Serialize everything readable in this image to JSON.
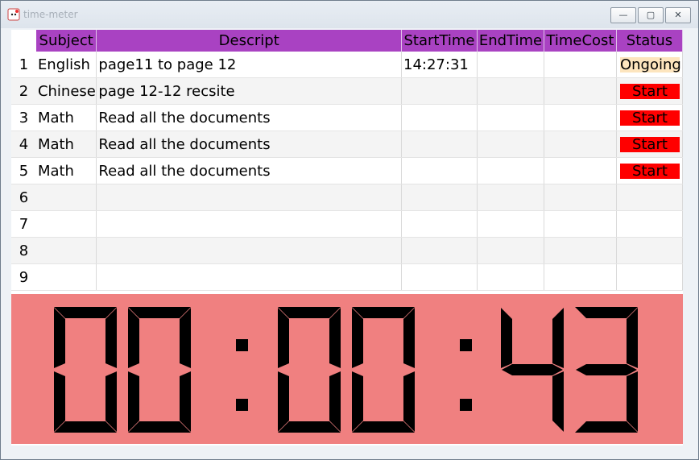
{
  "window": {
    "title": "time-meter",
    "minimize_glyph": "—",
    "maximize_glyph": "▢",
    "close_glyph": "✕"
  },
  "table": {
    "headers": [
      "Subject",
      "Descript",
      "StartTime",
      "EndTime",
      "TimeCost",
      "Status"
    ],
    "rows": [
      {
        "num": "1",
        "subject": "English",
        "descript": "page11 to page 12",
        "start": "14:27:31",
        "end": "",
        "cost": "",
        "status": "Ongoing"
      },
      {
        "num": "2",
        "subject": "Chinese",
        "descript": "page 12-12 recsite",
        "start": "",
        "end": "",
        "cost": "",
        "status": "Start"
      },
      {
        "num": "3",
        "subject": "Math",
        "descript": "Read all the documents",
        "start": "",
        "end": "",
        "cost": "",
        "status": "Start"
      },
      {
        "num": "4",
        "subject": "Math",
        "descript": "Read all the documents",
        "start": "",
        "end": "",
        "cost": "",
        "status": "Start"
      },
      {
        "num": "5",
        "subject": "Math",
        "descript": "Read all the documents",
        "start": "",
        "end": "",
        "cost": "",
        "status": "Start"
      },
      {
        "num": "6",
        "subject": "",
        "descript": "",
        "start": "",
        "end": "",
        "cost": "",
        "status": ""
      },
      {
        "num": "7",
        "subject": "",
        "descript": "",
        "start": "",
        "end": "",
        "cost": "",
        "status": ""
      },
      {
        "num": "8",
        "subject": "",
        "descript": "",
        "start": "",
        "end": "",
        "cost": "",
        "status": ""
      },
      {
        "num": "9",
        "subject": "",
        "descript": "",
        "start": "",
        "end": "",
        "cost": "",
        "status": ""
      }
    ]
  },
  "timer": {
    "display": "00:00:43"
  },
  "colors": {
    "header_bg": "#a942c2",
    "clock_bg": "#f08080",
    "ongoing_bg": "#fde5be",
    "start_bg": "#ff0000",
    "segment": "#000000"
  }
}
